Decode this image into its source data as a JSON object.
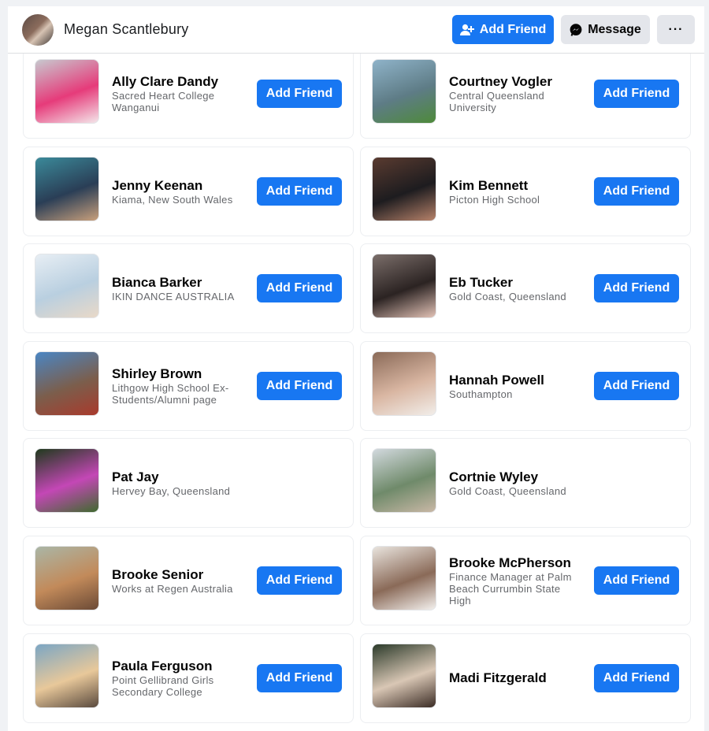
{
  "header": {
    "name": "Megan Scantlebury",
    "add_friend_label": "Add Friend",
    "message_label": "Message",
    "more_label": "···"
  },
  "colors": {
    "brand_blue": "#1877f2",
    "secondary_gray": "#e4e6eb",
    "muted_text": "#65676b"
  },
  "people": [
    {
      "name": "Ally Clare Dandy",
      "desc": "Sacred Heart College Wanganui",
      "button": "Add Friend",
      "photo": [
        "#c7c9cf",
        "#e63b7a",
        "#f4e6ea"
      ]
    },
    {
      "name": "Courtney Vogler",
      "desc": "Central Queensland University",
      "button": "Add Friend",
      "photo": [
        "#8fb3c9",
        "#5e7c86",
        "#4e8a3a"
      ]
    },
    {
      "name": "Jenny Keenan",
      "desc": "Kiama, New South Wales",
      "button": "Add Friend",
      "photo": [
        "#3b8a9a",
        "#2a3e56",
        "#c9a07c"
      ]
    },
    {
      "name": "Kim Bennett",
      "desc": "Picton High School",
      "button": "Add Friend",
      "photo": [
        "#5a3b30",
        "#1d1c1f",
        "#b7826a"
      ]
    },
    {
      "name": "Bianca Barker",
      "desc": "IKIN DANCE AUSTRALIA",
      "button": "Add Friend",
      "photo": [
        "#e7eef4",
        "#b9cfe0",
        "#e9d9c8"
      ]
    },
    {
      "name": "Eb Tucker",
      "desc": "Gold Coast, Queensland",
      "button": "Add Friend",
      "photo": [
        "#7b6e6a",
        "#2b2322",
        "#e3c3b7"
      ]
    },
    {
      "name": "Shirley Brown",
      "desc": "Lithgow High School Ex-Students/Alumni page",
      "button": "Add Friend",
      "photo": [
        "#4a86c4",
        "#7b5e4c",
        "#a93a2c"
      ]
    },
    {
      "name": "Hannah Powell",
      "desc": "Southampton",
      "button": "Add Friend",
      "photo": [
        "#8a6a58",
        "#d9b6a2",
        "#f2eeea"
      ]
    },
    {
      "name": "Pat Jay",
      "desc": "Hervey Bay, Queensland",
      "button": "",
      "photo": [
        "#1f3a1c",
        "#c447b6",
        "#3f6a2e"
      ]
    },
    {
      "name": "Cortnie Wyley",
      "desc": "Gold Coast, Queensland",
      "button": "",
      "photo": [
        "#d2d9de",
        "#6f8a6a",
        "#c9b8a6"
      ]
    },
    {
      "name": "Brooke Senior",
      "desc": "Works at Regen Australia",
      "button": "Add Friend",
      "photo": [
        "#aab6a6",
        "#c28a5a",
        "#6b4a36"
      ]
    },
    {
      "name": "Brooke McPherson",
      "desc": "Finance Manager at Palm Beach Currumbin State High",
      "button": "Add Friend",
      "photo": [
        "#e9e4de",
        "#8a6a58",
        "#f4f1ee"
      ]
    },
    {
      "name": "Paula Ferguson",
      "desc": "Point Gellibrand Girls Secondary College",
      "button": "Add Friend",
      "photo": [
        "#7ba6c4",
        "#e8c89a",
        "#5a4a3e"
      ]
    },
    {
      "name": "Madi Fitzgerald",
      "desc": "",
      "button": "Add Friend",
      "photo": [
        "#2b3a2a",
        "#d9c7b5",
        "#3b2c25"
      ]
    }
  ]
}
